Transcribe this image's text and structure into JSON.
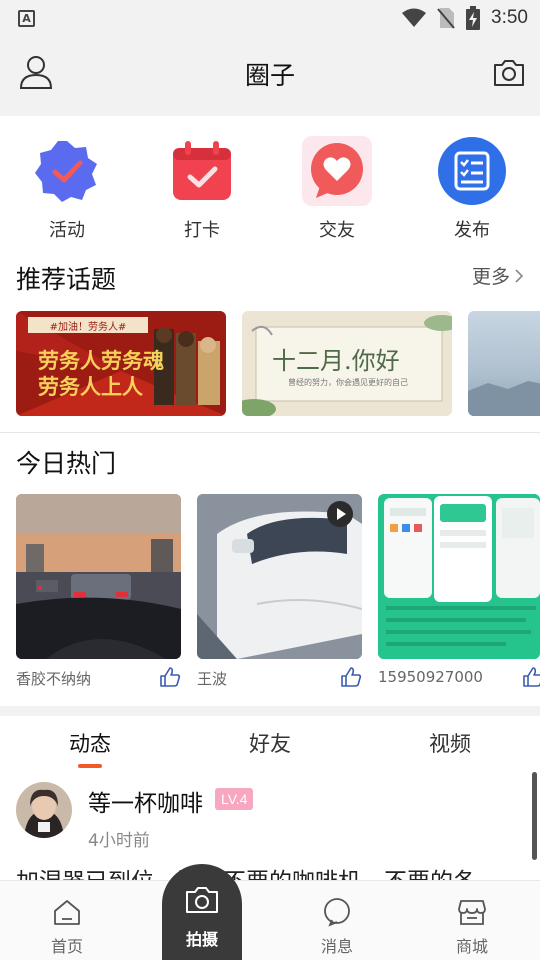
{
  "status_bar": {
    "time": "3:50",
    "app_indicator": "A"
  },
  "header": {
    "title": "圈子",
    "left_icon": "user-icon",
    "right_icon": "camera-icon"
  },
  "quick_actions": [
    {
      "label": "活动",
      "icon": "badge-check-icon",
      "color": "#5b6bf0"
    },
    {
      "label": "打卡",
      "icon": "calendar-check-icon",
      "color": "#f0434f"
    },
    {
      "label": "交友",
      "icon": "heart-chat-icon",
      "color": "#f15a5a"
    },
    {
      "label": "发布",
      "icon": "checklist-icon",
      "color": "#2f6fe8"
    }
  ],
  "topics": {
    "title": "推荐话题",
    "more": "更多",
    "cards": [
      {
        "banner_top": "#加油！劳务人#",
        "line1": "劳务人劳务魂",
        "line2": "劳务人上人"
      },
      {
        "headline": "十二月.你好",
        "subline": "曾经的努力，你会遇见更好的自己"
      },
      {
        "scene": "sky"
      }
    ]
  },
  "hot": {
    "title": "今日热门",
    "items": [
      {
        "author": "香胶不纳纳",
        "scene": "traffic-dusk"
      },
      {
        "author": "王波",
        "scene": "white-car",
        "is_video": true
      },
      {
        "author": "15950927000",
        "scene": "app-screens"
      }
    ]
  },
  "feed_tabs": [
    {
      "label": "动态",
      "active": true
    },
    {
      "label": "好友",
      "active": false
    },
    {
      "label": "视频",
      "active": false
    }
  ],
  "post": {
    "name": "等一杯咖啡",
    "level": "LV.4",
    "time": "4小时前",
    "text": "加湿器已到位，还有不要的咖啡机，不要的冬"
  },
  "bottom_nav": [
    {
      "label": "首页",
      "icon": "home-icon"
    },
    {
      "label": "拍摄",
      "icon": "camera-icon",
      "highlight": true
    },
    {
      "label": "消息",
      "icon": "message-icon"
    },
    {
      "label": "商城",
      "icon": "store-icon"
    }
  ],
  "colors": {
    "accent": "#f05a28",
    "level_badge": "#f7a8c0",
    "header_bg": "#f2f2f2"
  }
}
